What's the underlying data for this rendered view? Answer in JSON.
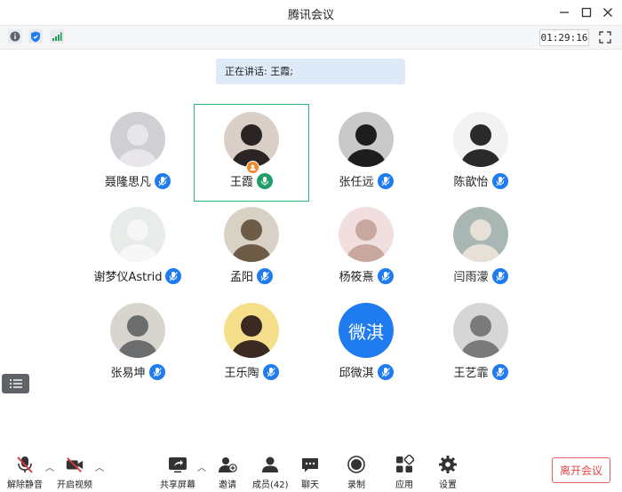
{
  "window": {
    "title": "腾讯会议"
  },
  "statusbar": {
    "timer": "01:29:16"
  },
  "speaking": "正在讲话: 王霞;",
  "participants": [
    {
      "name": "聂隆思凡",
      "bg": "#cfcfd4",
      "fg": "#e8e6ea"
    },
    {
      "name": "王霞",
      "bg": "#d9cfc7",
      "fg": "#2b2424"
    },
    {
      "name": "张任远",
      "bg": "#c9c9c9",
      "fg": "#1d1d1d"
    },
    {
      "name": "陈歆怡",
      "bg": "#f2f2f2",
      "fg": "#2a2a2a"
    },
    {
      "name": "谢梦仪Astrid",
      "bg": "#e7ece8",
      "fg": "#f7f7f7"
    },
    {
      "name": "孟阳",
      "bg": "#d8d1c6",
      "fg": "#6d5b45"
    },
    {
      "name": "杨筱熹",
      "bg": "#f1dfe0",
      "fg": "#c7a79e"
    },
    {
      "name": "闫雨濛",
      "bg": "#a9b7b4",
      "fg": "#e6e0d6"
    },
    {
      "name": "张易坤",
      "bg": "#d7d5cd",
      "fg": "#6c6d6e"
    },
    {
      "name": "王乐陶",
      "bg": "#f6df8a",
      "fg": "#3a2a22"
    },
    {
      "name": "邱微淇",
      "bg": "#1f7bf0",
      "fg": "#ffffff",
      "text": "微淇"
    },
    {
      "name": "王艺霏",
      "bg": "#d6d6d6",
      "fg": "#7a7a7a"
    }
  ],
  "toolbar": {
    "unmute": "解除静音",
    "video": "开启视频",
    "share": "共享屏幕",
    "invite": "邀请",
    "members": "成员(42)",
    "chat": "聊天",
    "record": "录制",
    "apps": "应用",
    "settings": "设置",
    "leave": "离开会议"
  }
}
